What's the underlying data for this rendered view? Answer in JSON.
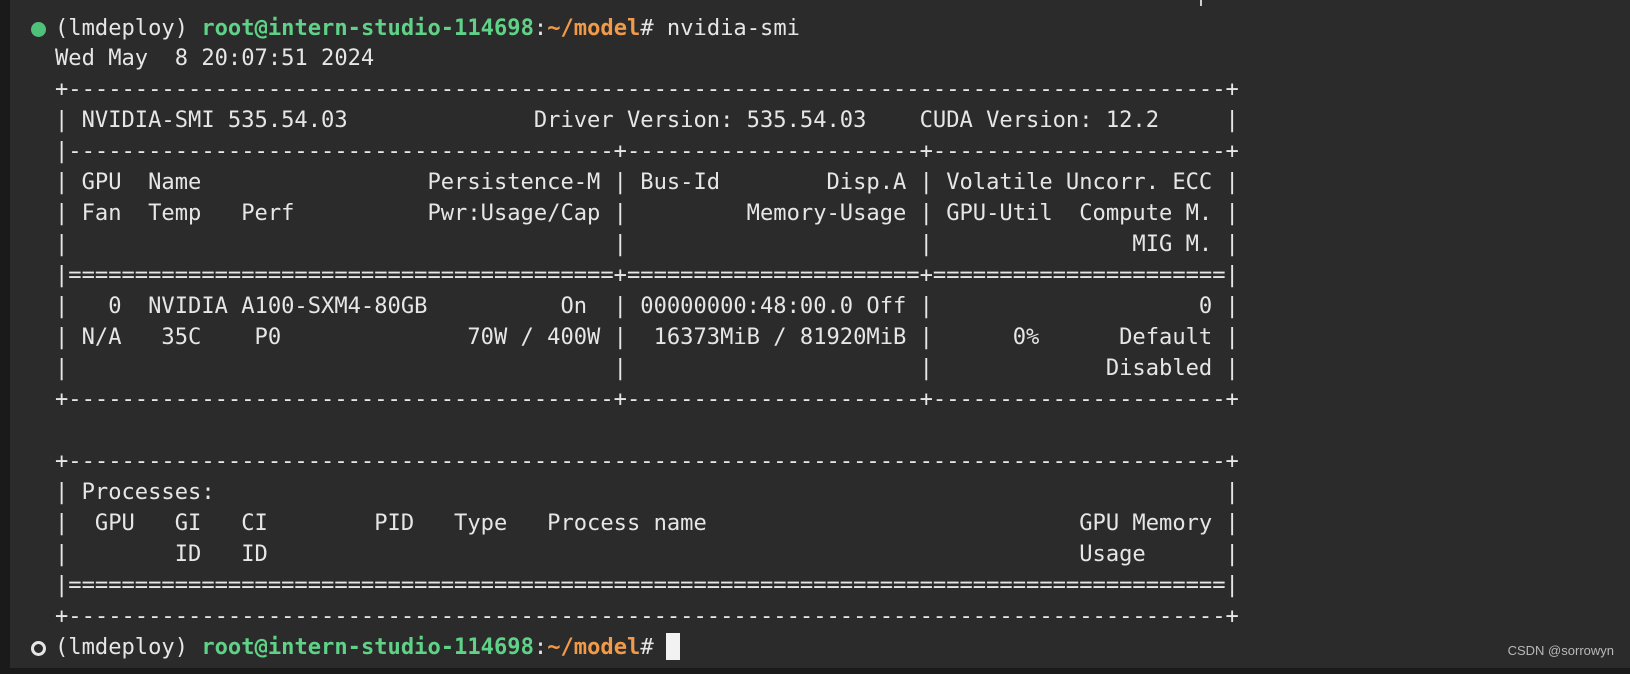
{
  "prompt": {
    "env": "(lmdeploy)",
    "user_host": "root@intern-studio-114698",
    "separator": ":",
    "path": "~/model",
    "symbol": "#"
  },
  "command": " nvidia-smi",
  "output_lines": [
    "Wed May  8 20:07:51 2024",
    "+---------------------------------------------------------------------------------------+",
    "| NVIDIA-SMI 535.54.03              Driver Version: 535.54.03    CUDA Version: 12.2     |",
    "|-----------------------------------------+----------------------+----------------------+",
    "| GPU  Name                 Persistence-M | Bus-Id        Disp.A | Volatile Uncorr. ECC |",
    "| Fan  Temp   Perf          Pwr:Usage/Cap |         Memory-Usage | GPU-Util  Compute M. |",
    "|                                         |                      |               MIG M. |",
    "|=========================================+======================+======================|",
    "|   0  NVIDIA A100-SXM4-80GB          On  | 00000000:48:00.0 Off |                    0 |",
    "| N/A   35C    P0              70W / 400W |  16373MiB / 81920MiB |      0%      Default |",
    "|                                         |                      |             Disabled |",
    "+-----------------------------------------+----------------------+----------------------+",
    "",
    "+---------------------------------------------------------------------------------------+",
    "| Processes:                                                                            |",
    "|  GPU   GI   CI        PID   Type   Process name                            GPU Memory |",
    "|        ID   ID                                                             Usage      |",
    "|=======================================================================================|",
    "+---------------------------------------------------------------------------------------+"
  ],
  "watermark": "CSDN @sorrowyn",
  "colors": {
    "background": "#2b2b2b",
    "text": "#e6e6e6",
    "user_host": "#5fd287",
    "path": "#f09a4a",
    "status_dot": "#4ec27a"
  }
}
